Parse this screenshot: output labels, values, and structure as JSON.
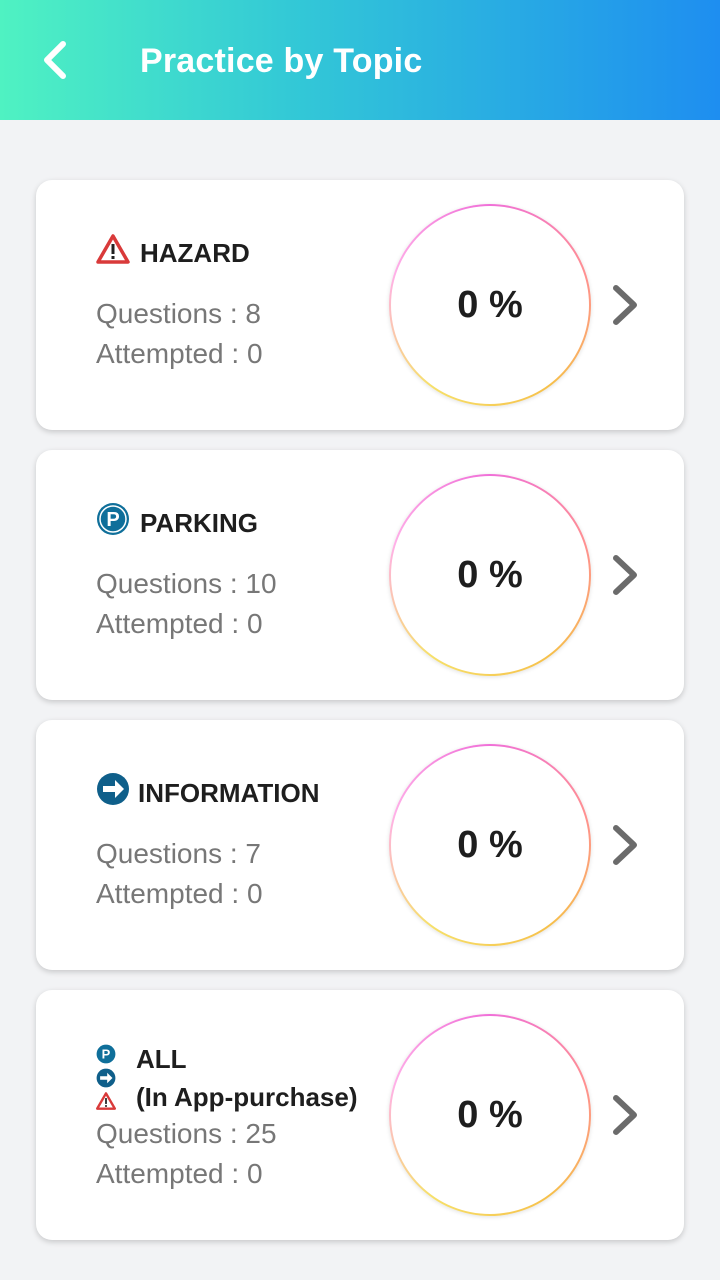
{
  "header": {
    "title": "Practice by Topic",
    "back_icon": "chevron-left-icon",
    "gradient_start": "#4ff2c2",
    "gradient_end": "#1e8ef0"
  },
  "topics": [
    {
      "name": "HAZARD",
      "icon": "hazard-triangle-icon",
      "questions": "Questions : 8",
      "attempted": "Attempted : 0",
      "progress": "0 %"
    },
    {
      "name": "PARKING",
      "icon": "parking-icon",
      "questions": "Questions : 10",
      "attempted": "Attempted : 0",
      "progress": "0 %"
    },
    {
      "name": "INFORMATION",
      "icon": "information-arrow-icon",
      "questions": "Questions : 7",
      "attempted": "Attempted : 0",
      "progress": "0 %"
    },
    {
      "name_line1": "ALL",
      "name_line2": "(In App-purchase)",
      "icons": [
        "parking-icon",
        "information-arrow-icon",
        "hazard-triangle-icon"
      ],
      "questions": "Questions : 25",
      "attempted": "Attempted : 0",
      "progress": "0 %"
    }
  ],
  "colors": {
    "hazard": "#d93a3a",
    "parking": "#0f6f9a",
    "information": "#0f5f8a"
  }
}
